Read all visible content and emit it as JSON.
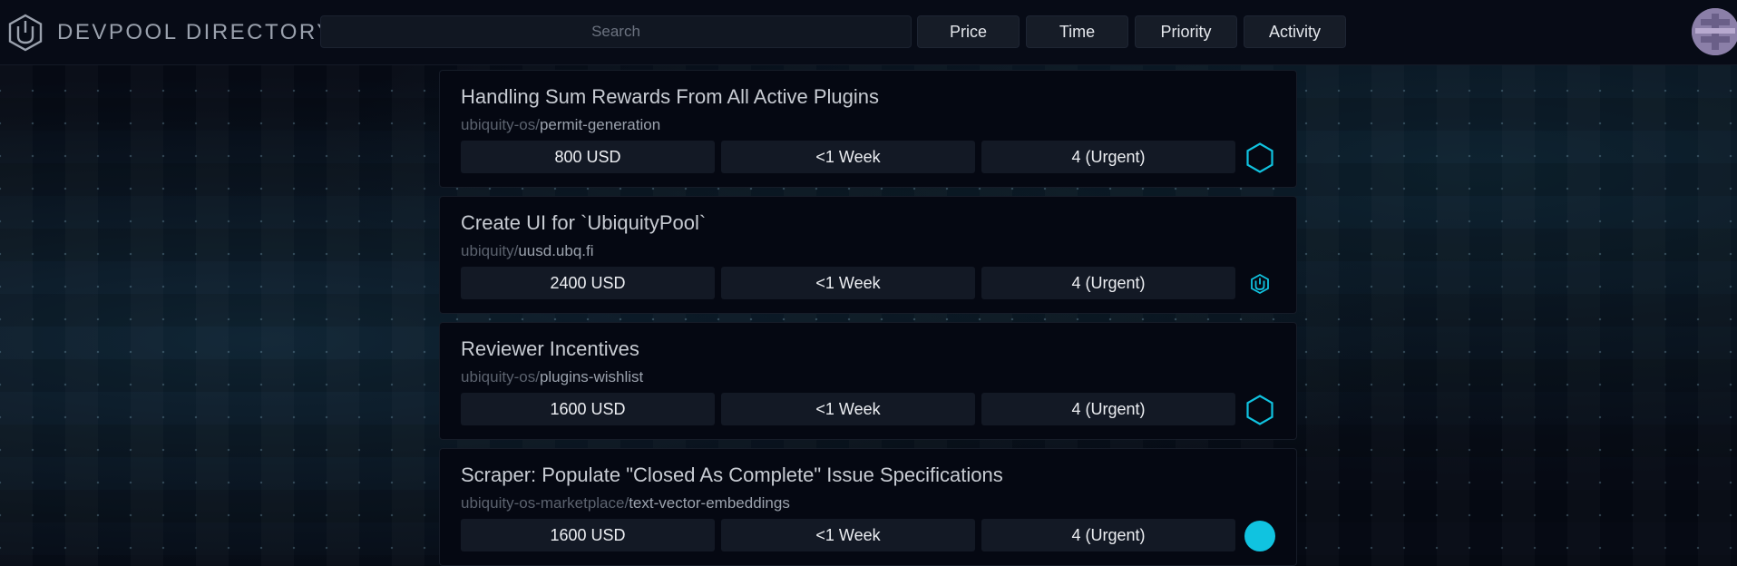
{
  "header": {
    "logo_text": "DEVPOOL DIRECTORY",
    "search_placeholder": "Search",
    "sort_buttons": [
      "Price",
      "Time",
      "Priority",
      "Activity"
    ]
  },
  "issues": [
    {
      "title": "Handling Sum Rewards From All Active Plugins",
      "org": "ubiquity-os/",
      "repo": "permit-generation",
      "price": "800 USD",
      "time": "<1 Week",
      "priority": "4 (Urgent)",
      "icon": "hexagon-outline-icon"
    },
    {
      "title": "Create UI for `UbiquityPool`",
      "org": "ubiquity/",
      "repo": "uusd.ubq.fi",
      "price": "2400 USD",
      "time": "<1 Week",
      "priority": "4 (Urgent)",
      "icon": "ubiquity-logo-icon"
    },
    {
      "title": "Reviewer Incentives",
      "org": "ubiquity-os/",
      "repo": "plugins-wishlist",
      "price": "1600 USD",
      "time": "<1 Week",
      "priority": "4 (Urgent)",
      "icon": "hexagon-outline-icon"
    },
    {
      "title": "Scraper: Populate \"Closed As Complete\" Issue Specifications",
      "org": "ubiquity-os-marketplace/",
      "repo": "text-vector-embeddings",
      "price": "1600 USD",
      "time": "<1 Week",
      "priority": "4 (Urgent)",
      "icon": "cyan-circle-icon"
    }
  ],
  "colors": {
    "accent": "#10c3e0",
    "background": "#060a14",
    "card": "#050812",
    "pill": "#131925"
  }
}
